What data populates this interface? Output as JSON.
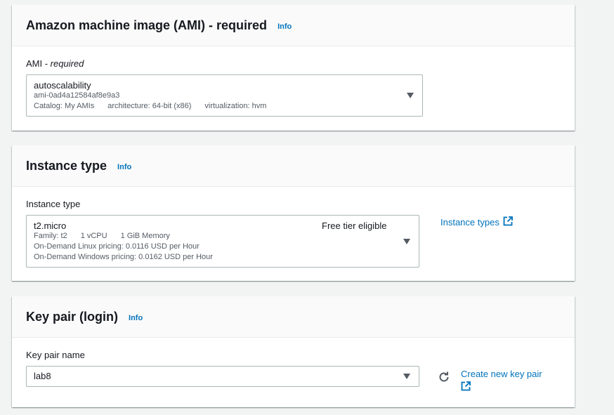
{
  "ami_section": {
    "title": "Amazon machine image (AMI) - required",
    "info": "Info",
    "label_prefix": "AMI - ",
    "label_required": "required",
    "selected_name": "autoscalability",
    "selected_id": "ami-0ad4a12584af8e9a3",
    "catalog": "Catalog: My AMIs",
    "architecture": "architecture: 64-bit (x86)",
    "virtualization": "virtualization: hvm"
  },
  "instance_section": {
    "title": "Instance type",
    "info": "Info",
    "label": "Instance type",
    "selected_name": "t2.micro",
    "badge": "Free tier eligible",
    "family": "Family: t2",
    "vcpu": "1 vCPU",
    "memory": "1 GiB Memory",
    "linux_pricing": "On-Demand Linux pricing: 0.0116 USD per Hour",
    "windows_pricing": "On-Demand Windows pricing: 0.0162 USD per Hour",
    "types_link": "Instance types"
  },
  "keypair_section": {
    "title": "Key pair (login)",
    "info": "Info",
    "label": "Key pair name",
    "selected_name": "lab8",
    "create_link": "Create new key pair"
  },
  "icons": {
    "caret": "chevron-down-icon",
    "external": "external-link-icon",
    "refresh": "refresh-icon"
  },
  "colors": {
    "link": "#0073bb",
    "text": "#16191f",
    "secondary_text": "#545b64",
    "border": "#aab7b8",
    "background": "#f2f3f3"
  }
}
